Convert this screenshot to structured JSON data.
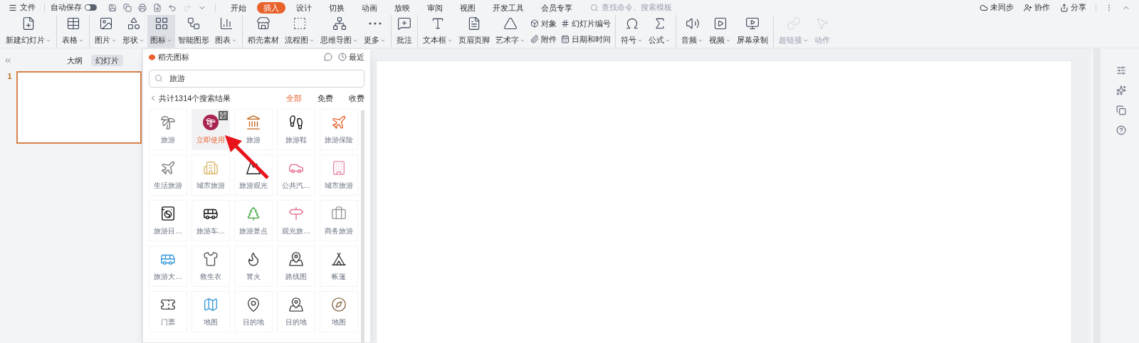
{
  "menubar": {
    "file": "文件",
    "autosave": {
      "label": "自动保存",
      "on": false
    },
    "tabs": [
      {
        "label": "开始",
        "selected": false
      },
      {
        "label": "插入",
        "selected": true
      },
      {
        "label": "设计",
        "selected": false
      },
      {
        "label": "切换",
        "selected": false
      },
      {
        "label": "动画",
        "selected": false
      },
      {
        "label": "放映",
        "selected": false
      },
      {
        "label": "审阅",
        "selected": false
      },
      {
        "label": "视图",
        "selected": false
      },
      {
        "label": "开发工具",
        "selected": false
      },
      {
        "label": "会员专享",
        "selected": false
      }
    ],
    "search": {
      "placeholder": "查找命令、搜索模板"
    },
    "actions": [
      "未同步",
      "协作",
      "分享"
    ]
  },
  "ribbon": [
    {
      "kind": "large",
      "label": "新建幻灯片",
      "dropdown": true,
      "selected": false,
      "disabled": false
    },
    {
      "kind": "large",
      "label": "表格",
      "dropdown": true,
      "selected": false,
      "disabled": false,
      "group_start": true
    },
    {
      "kind": "large",
      "label": "图片",
      "dropdown": true,
      "selected": false,
      "disabled": false,
      "group_start": true
    },
    {
      "kind": "large",
      "label": "形状",
      "dropdown": true,
      "selected": false,
      "disabled": false,
      "group_start": false
    },
    {
      "kind": "large",
      "label": "图标",
      "dropdown": true,
      "selected": true,
      "disabled": false,
      "group_start": false
    },
    {
      "kind": "large",
      "label": "智能图形",
      "dropdown": false,
      "selected": false,
      "disabled": false,
      "group_start": false
    },
    {
      "kind": "large",
      "label": "图表",
      "dropdown": true,
      "selected": false,
      "disabled": false,
      "group_start": false
    },
    {
      "kind": "large",
      "label": "稻壳素材",
      "dropdown": false,
      "selected": false,
      "disabled": false,
      "group_start": true
    },
    {
      "kind": "large",
      "label": "流程图",
      "dropdown": true,
      "selected": false,
      "disabled": false,
      "group_start": false
    },
    {
      "kind": "large",
      "label": "思维导图",
      "dropdown": true,
      "selected": false,
      "disabled": false,
      "group_start": false
    },
    {
      "kind": "large",
      "label": "更多",
      "dropdown": true,
      "selected": false,
      "disabled": false,
      "group_start": false
    },
    {
      "kind": "large",
      "label": "批注",
      "dropdown": false,
      "selected": false,
      "disabled": false,
      "group_start": true
    },
    {
      "kind": "large",
      "label": "文本框",
      "dropdown": true,
      "selected": false,
      "disabled": false,
      "group_start": true
    },
    {
      "kind": "large",
      "label": "页眉页脚",
      "dropdown": false,
      "selected": false,
      "disabled": false,
      "group_start": false
    },
    {
      "kind": "large",
      "label": "艺术字",
      "dropdown": true,
      "selected": false,
      "disabled": false,
      "group_start": false
    },
    {
      "kind": "small",
      "labels": [
        "对象",
        "附件"
      ]
    },
    {
      "kind": "small",
      "labels": [
        "幻灯片编号",
        "日期和时间"
      ]
    },
    {
      "kind": "large",
      "label": "符号",
      "dropdown": true,
      "selected": false,
      "disabled": false,
      "group_start": true
    },
    {
      "kind": "large",
      "label": "公式",
      "dropdown": true,
      "selected": false,
      "disabled": false,
      "group_start": false
    },
    {
      "kind": "large",
      "label": "音频",
      "dropdown": true,
      "selected": false,
      "disabled": false,
      "group_start": true
    },
    {
      "kind": "large",
      "label": "视频",
      "dropdown": true,
      "selected": false,
      "disabled": false,
      "group_start": false
    },
    {
      "kind": "large",
      "label": "屏幕录制",
      "dropdown": false,
      "selected": false,
      "disabled": false,
      "group_start": false
    },
    {
      "kind": "large",
      "label": "超链接",
      "dropdown": true,
      "selected": false,
      "disabled": true,
      "group_start": true
    },
    {
      "kind": "large",
      "label": "动作",
      "dropdown": false,
      "selected": false,
      "disabled": true,
      "group_start": false
    }
  ],
  "slide_panel": {
    "tabs": [
      {
        "label": "大纲",
        "selected": false
      },
      {
        "label": "幻灯片",
        "selected": true
      }
    ],
    "slides": [
      {
        "number": "1",
        "selected": true
      }
    ]
  },
  "icon_panel": {
    "title": "稻壳图标",
    "recent": "最近",
    "search": {
      "value": "旅游"
    },
    "result_count": "共计1314个搜索结果",
    "filters": [
      {
        "label": "全部",
        "selected": true
      },
      {
        "label": "免费",
        "selected": false
      },
      {
        "label": "收费",
        "selected": false
      }
    ],
    "icons": [
      {
        "label": "旅游",
        "hovered": false
      },
      {
        "label": "立即使用",
        "hovered": true
      },
      {
        "label": "旅游",
        "hovered": false
      },
      {
        "label": "旅游鞋",
        "hovered": false
      },
      {
        "label": "旅游保险",
        "hovered": false
      },
      {
        "label": "生活旅游",
        "hovered": false
      },
      {
        "label": "城市旅游",
        "hovered": false
      },
      {
        "label": "旅游观光",
        "hovered": false
      },
      {
        "label": "公共汽…",
        "hovered": false
      },
      {
        "label": "城市旅游",
        "hovered": false
      },
      {
        "label": "旅游目…",
        "hovered": false
      },
      {
        "label": "旅游车…",
        "hovered": false
      },
      {
        "label": "旅游景点",
        "hovered": false
      },
      {
        "label": "观光旅…",
        "hovered": false
      },
      {
        "label": "商务旅游",
        "hovered": false
      },
      {
        "label": "旅游大…",
        "hovered": false
      },
      {
        "label": "救生衣",
        "hovered": false
      },
      {
        "label": "篝火",
        "hovered": false
      },
      {
        "label": "路线图",
        "hovered": false
      },
      {
        "label": "帐篷",
        "hovered": false
      },
      {
        "label": "门票",
        "hovered": false
      },
      {
        "label": "地图",
        "hovered": false
      },
      {
        "label": "目的地",
        "hovered": false
      },
      {
        "label": "目的地",
        "hovered": false
      },
      {
        "label": "地图",
        "hovered": false
      }
    ]
  }
}
